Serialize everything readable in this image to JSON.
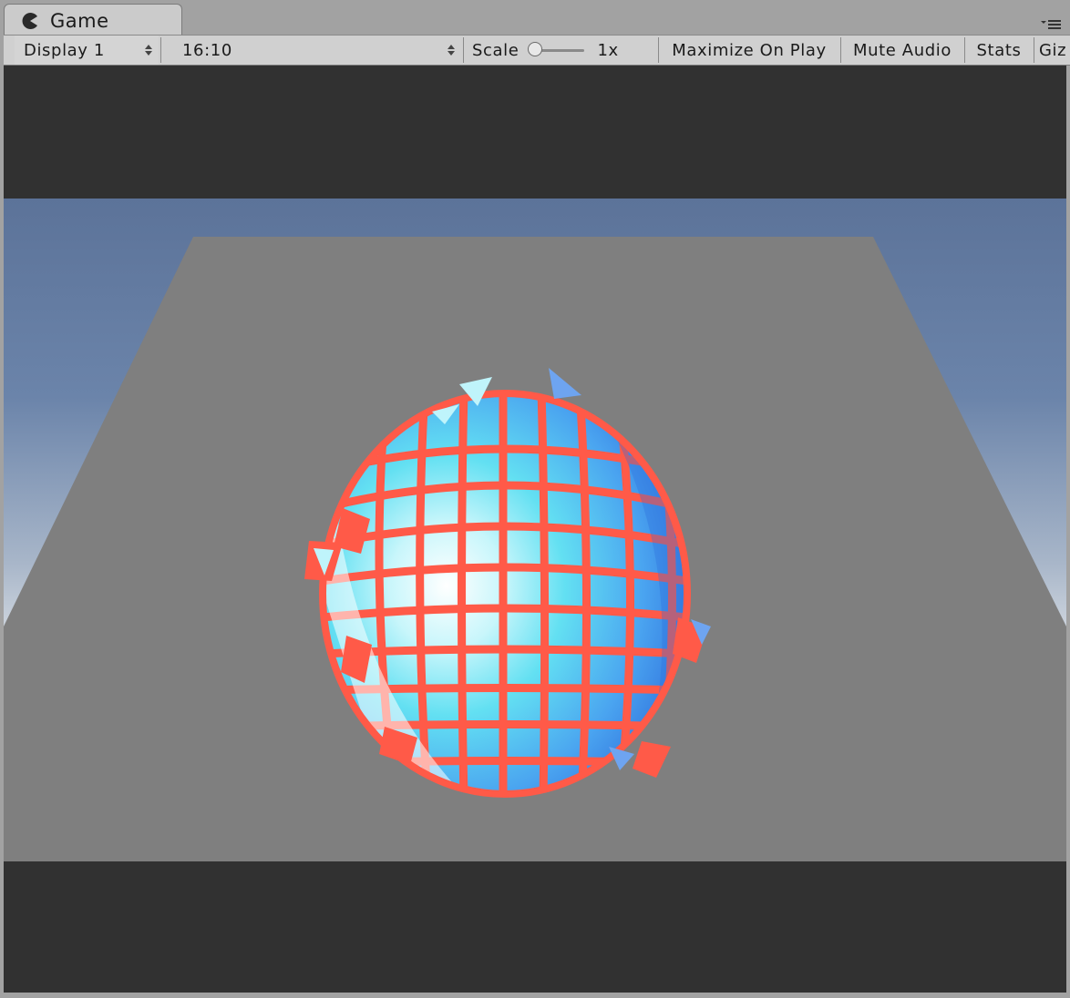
{
  "window": {
    "tab_label": "Game",
    "tab_icon": "pacman-icon",
    "menu_icon": "panel-menu-icon"
  },
  "toolbar": {
    "display_select": "Display 1",
    "aspect_select": "16:10",
    "scale_label": "Scale",
    "scale_value": "1x",
    "scale_level": 0,
    "maximize_label": "Maximize On Play",
    "mute_label": "Mute Audio",
    "stats_label": "Stats",
    "gizmos_label": "Giz"
  },
  "scene": {
    "sky_top_color": "#5c7399",
    "sky_horizon_color": "#d8dde3",
    "ground_color": "#7f7f7f",
    "floor_color": "#6e6666",
    "plane_color": "#7f7f7f",
    "sphere_tile_color": "#63e0f2",
    "sphere_edge_color": "#ff5a48",
    "letterbox_color": "#313131"
  }
}
